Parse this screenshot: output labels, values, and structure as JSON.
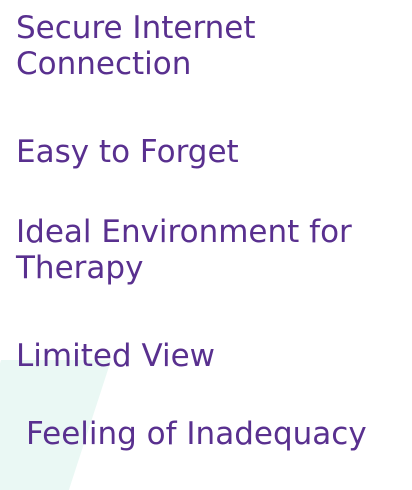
{
  "items": [
    {
      "label": "Secure Internet Connection"
    },
    {
      "label": "Easy to Forget"
    },
    {
      "label": "Ideal Environment for Therapy"
    },
    {
      "label": "Limited View"
    },
    {
      "label": "Feeling of Inadequacy"
    }
  ],
  "colors": {
    "text": "#59308f",
    "accent": "#eaf8f4",
    "background": "#ffffff"
  }
}
